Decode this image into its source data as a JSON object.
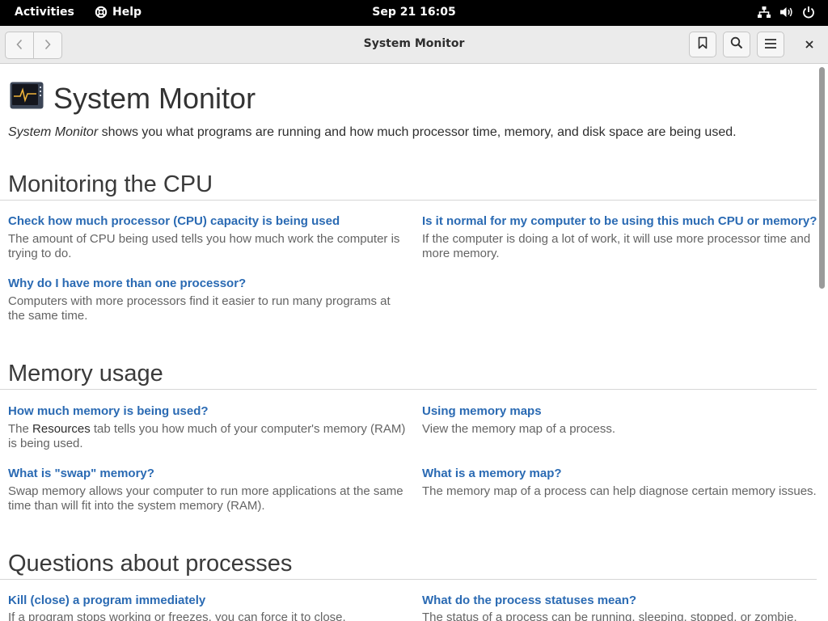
{
  "topbar": {
    "activities": "Activities",
    "app_name": "Help",
    "clock": "Sep 21  16:05"
  },
  "window": {
    "title": "System Monitor"
  },
  "page": {
    "title": "System Monitor",
    "intro_app": "System Monitor",
    "intro_rest": " shows you what programs are running and how much processor time, memory, and disk space are being used."
  },
  "sections": [
    {
      "title": "Monitoring the CPU",
      "links": [
        {
          "title": "Check how much processor (CPU) capacity is being used",
          "desc": "The amount of CPU being used tells you how much work the computer is trying to do."
        },
        {
          "title": "Is it normal for my computer to be using this much CPU or memory?",
          "desc": "If the computer is doing a lot of work, it will use more processor time and more memory."
        },
        {
          "title": "Why do I have more than one processor?",
          "desc": "Computers with more processors find it easier to run many programs at the same time."
        }
      ]
    },
    {
      "title": "Memory usage",
      "links": [
        {
          "title": "How much memory is being used?",
          "desc_pre": "The ",
          "desc_kw": "Resources",
          "desc_post": " tab tells you how much of your computer's memory (RAM) is being used."
        },
        {
          "title": "Using memory maps",
          "desc": "View the memory map of a process."
        },
        {
          "title": "What is \"swap\" memory?",
          "desc": "Swap memory allows your computer to run more applications at the same time than will fit into the system memory (RAM)."
        },
        {
          "title": "What is a memory map?",
          "desc": "The memory map of a process can help diagnose certain memory issues."
        }
      ]
    },
    {
      "title": "Questions about processes",
      "links": [
        {
          "title": "Kill (close) a program immediately",
          "desc": "If a program stops working or freezes, you can force it to close."
        },
        {
          "title": "What do the process statuses mean?",
          "desc": "The status of a process can be running, sleeping, stopped, or zombie."
        }
      ]
    }
  ]
}
